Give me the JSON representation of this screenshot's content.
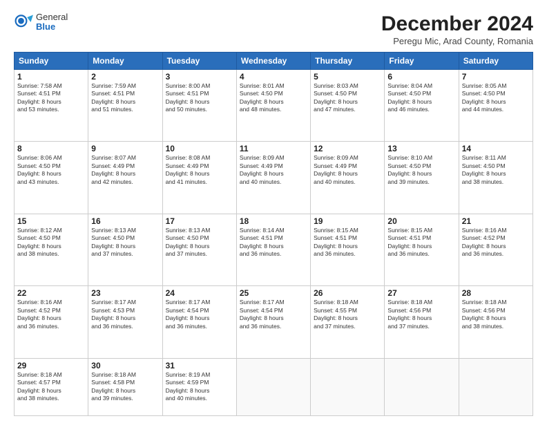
{
  "logo": {
    "general": "General",
    "blue": "Blue"
  },
  "header": {
    "month": "December 2024",
    "location": "Peregu Mic, Arad County, Romania"
  },
  "weekdays": [
    "Sunday",
    "Monday",
    "Tuesday",
    "Wednesday",
    "Thursday",
    "Friday",
    "Saturday"
  ],
  "weeks": [
    [
      {
        "day": 1,
        "info": "Sunrise: 7:58 AM\nSunset: 4:51 PM\nDaylight: 8 hours\nand 53 minutes."
      },
      {
        "day": 2,
        "info": "Sunrise: 7:59 AM\nSunset: 4:51 PM\nDaylight: 8 hours\nand 51 minutes."
      },
      {
        "day": 3,
        "info": "Sunrise: 8:00 AM\nSunset: 4:51 PM\nDaylight: 8 hours\nand 50 minutes."
      },
      {
        "day": 4,
        "info": "Sunrise: 8:01 AM\nSunset: 4:50 PM\nDaylight: 8 hours\nand 48 minutes."
      },
      {
        "day": 5,
        "info": "Sunrise: 8:03 AM\nSunset: 4:50 PM\nDaylight: 8 hours\nand 47 minutes."
      },
      {
        "day": 6,
        "info": "Sunrise: 8:04 AM\nSunset: 4:50 PM\nDaylight: 8 hours\nand 46 minutes."
      },
      {
        "day": 7,
        "info": "Sunrise: 8:05 AM\nSunset: 4:50 PM\nDaylight: 8 hours\nand 44 minutes."
      }
    ],
    [
      {
        "day": 8,
        "info": "Sunrise: 8:06 AM\nSunset: 4:50 PM\nDaylight: 8 hours\nand 43 minutes."
      },
      {
        "day": 9,
        "info": "Sunrise: 8:07 AM\nSunset: 4:49 PM\nDaylight: 8 hours\nand 42 minutes."
      },
      {
        "day": 10,
        "info": "Sunrise: 8:08 AM\nSunset: 4:49 PM\nDaylight: 8 hours\nand 41 minutes."
      },
      {
        "day": 11,
        "info": "Sunrise: 8:09 AM\nSunset: 4:49 PM\nDaylight: 8 hours\nand 40 minutes."
      },
      {
        "day": 12,
        "info": "Sunrise: 8:09 AM\nSunset: 4:49 PM\nDaylight: 8 hours\nand 40 minutes."
      },
      {
        "day": 13,
        "info": "Sunrise: 8:10 AM\nSunset: 4:50 PM\nDaylight: 8 hours\nand 39 minutes."
      },
      {
        "day": 14,
        "info": "Sunrise: 8:11 AM\nSunset: 4:50 PM\nDaylight: 8 hours\nand 38 minutes."
      }
    ],
    [
      {
        "day": 15,
        "info": "Sunrise: 8:12 AM\nSunset: 4:50 PM\nDaylight: 8 hours\nand 38 minutes."
      },
      {
        "day": 16,
        "info": "Sunrise: 8:13 AM\nSunset: 4:50 PM\nDaylight: 8 hours\nand 37 minutes."
      },
      {
        "day": 17,
        "info": "Sunrise: 8:13 AM\nSunset: 4:50 PM\nDaylight: 8 hours\nand 37 minutes."
      },
      {
        "day": 18,
        "info": "Sunrise: 8:14 AM\nSunset: 4:51 PM\nDaylight: 8 hours\nand 36 minutes."
      },
      {
        "day": 19,
        "info": "Sunrise: 8:15 AM\nSunset: 4:51 PM\nDaylight: 8 hours\nand 36 minutes."
      },
      {
        "day": 20,
        "info": "Sunrise: 8:15 AM\nSunset: 4:51 PM\nDaylight: 8 hours\nand 36 minutes."
      },
      {
        "day": 21,
        "info": "Sunrise: 8:16 AM\nSunset: 4:52 PM\nDaylight: 8 hours\nand 36 minutes."
      }
    ],
    [
      {
        "day": 22,
        "info": "Sunrise: 8:16 AM\nSunset: 4:52 PM\nDaylight: 8 hours\nand 36 minutes."
      },
      {
        "day": 23,
        "info": "Sunrise: 8:17 AM\nSunset: 4:53 PM\nDaylight: 8 hours\nand 36 minutes."
      },
      {
        "day": 24,
        "info": "Sunrise: 8:17 AM\nSunset: 4:54 PM\nDaylight: 8 hours\nand 36 minutes."
      },
      {
        "day": 25,
        "info": "Sunrise: 8:17 AM\nSunset: 4:54 PM\nDaylight: 8 hours\nand 36 minutes."
      },
      {
        "day": 26,
        "info": "Sunrise: 8:18 AM\nSunset: 4:55 PM\nDaylight: 8 hours\nand 37 minutes."
      },
      {
        "day": 27,
        "info": "Sunrise: 8:18 AM\nSunset: 4:56 PM\nDaylight: 8 hours\nand 37 minutes."
      },
      {
        "day": 28,
        "info": "Sunrise: 8:18 AM\nSunset: 4:56 PM\nDaylight: 8 hours\nand 38 minutes."
      }
    ],
    [
      {
        "day": 29,
        "info": "Sunrise: 8:18 AM\nSunset: 4:57 PM\nDaylight: 8 hours\nand 38 minutes."
      },
      {
        "day": 30,
        "info": "Sunrise: 8:18 AM\nSunset: 4:58 PM\nDaylight: 8 hours\nand 39 minutes."
      },
      {
        "day": 31,
        "info": "Sunrise: 8:19 AM\nSunset: 4:59 PM\nDaylight: 8 hours\nand 40 minutes."
      },
      null,
      null,
      null,
      null
    ]
  ]
}
